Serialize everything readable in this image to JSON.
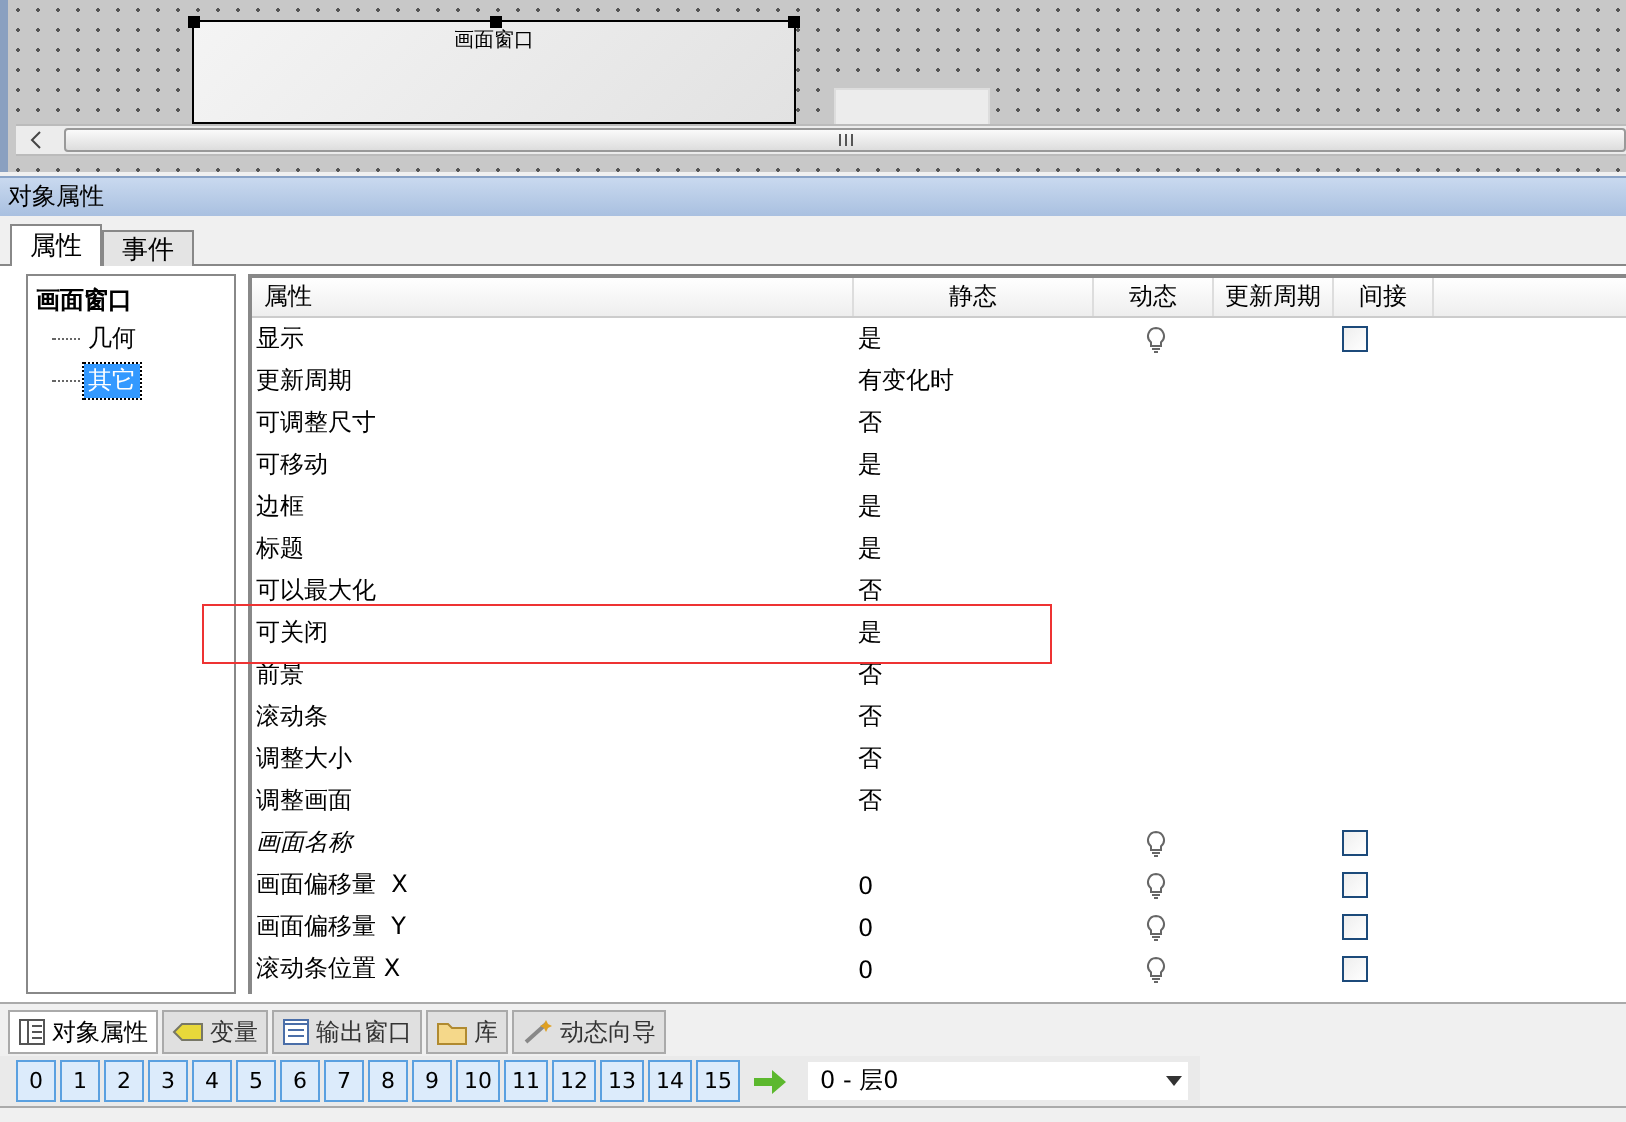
{
  "canvas": {
    "window_object": {
      "title": "画面窗口"
    }
  },
  "panel": {
    "title": "对象属性",
    "tabs": [
      {
        "label": "属性",
        "selected": true
      },
      {
        "label": "事件",
        "selected": false
      }
    ],
    "tree": {
      "label": "画面窗口",
      "children": [
        {
          "label": "几何",
          "selected": false
        },
        {
          "label": "其它",
          "selected": true
        }
      ]
    },
    "table": {
      "columns": [
        "属性",
        "静态",
        "动态",
        "更新周期",
        "间接"
      ],
      "rows": [
        {
          "name": "显示",
          "static": "是",
          "italic": false,
          "bulb": true,
          "indirect": {
            "checked": false
          }
        },
        {
          "name": "更新周期",
          "static": "有变化时",
          "italic": false,
          "bulb": false
        },
        {
          "name": "可调整尺寸",
          "static": "否",
          "italic": false,
          "bulb": false
        },
        {
          "name": "可移动",
          "static": "是",
          "italic": false,
          "bulb": false
        },
        {
          "name": "边框",
          "static": "是",
          "italic": false,
          "bulb": false
        },
        {
          "name": "标题",
          "static": "是",
          "italic": false,
          "bulb": false
        },
        {
          "name": "可以最大化",
          "static": "否",
          "italic": false,
          "bulb": false
        },
        {
          "name": "可关闭",
          "static": "是",
          "italic": false,
          "bulb": false,
          "highlighted": true
        },
        {
          "name": "前景",
          "static": "否",
          "italic": false,
          "bulb": false
        },
        {
          "name": "滚动条",
          "static": "否",
          "italic": false,
          "bulb": false
        },
        {
          "name": "调整大小",
          "static": "否",
          "italic": false,
          "bulb": false
        },
        {
          "name": "调整画面",
          "static": "否",
          "italic": false,
          "bulb": false
        },
        {
          "name": "画面名称",
          "italic": true,
          "bulb": true,
          "indirect": {
            "checked": false
          }
        },
        {
          "name": "画面偏移量  X",
          "static": "0",
          "italic": false,
          "bulb": true,
          "indirect": {
            "checked": false
          }
        },
        {
          "name": "画面偏移量  Y",
          "static": "0",
          "italic": false,
          "bulb": true,
          "indirect": {
            "checked": false
          }
        },
        {
          "name": "滚动条位置 X",
          "static": "0",
          "italic": false,
          "bulb": true,
          "indirect": {
            "checked": false
          }
        }
      ]
    }
  },
  "bottom_tabs": [
    {
      "label": "对象属性",
      "kind": "list",
      "selected": true
    },
    {
      "label": "变量",
      "kind": "tag",
      "selected": false
    },
    {
      "label": "输出窗口",
      "kind": "output",
      "selected": false
    },
    {
      "label": "库",
      "kind": "folder",
      "selected": false
    },
    {
      "label": "动态向导",
      "kind": "wand",
      "selected": false
    }
  ],
  "layer_bar": {
    "layers": [
      "0",
      "1",
      "2",
      "3",
      "4",
      "5",
      "6",
      "7",
      "8",
      "9",
      "10",
      "11",
      "12",
      "13",
      "14",
      "15"
    ],
    "layer_select": "0 - 层0"
  }
}
